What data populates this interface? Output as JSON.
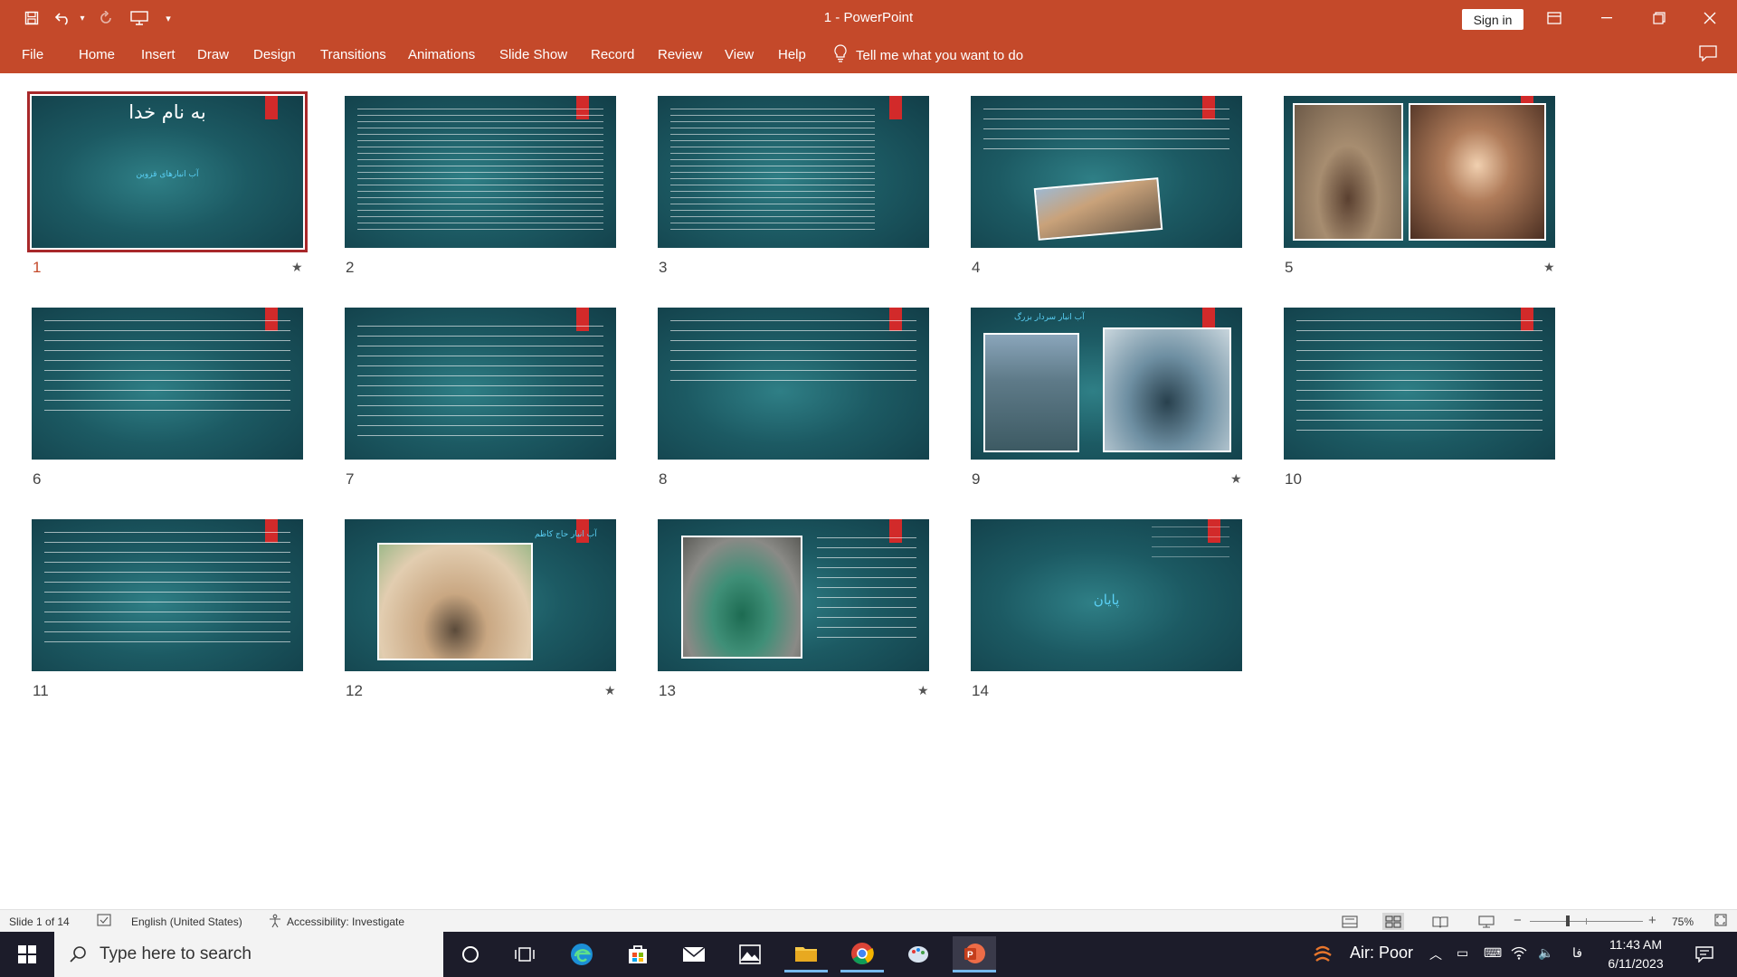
{
  "app": {
    "title": "1  -  PowerPoint",
    "sign_in": "Sign in",
    "colors": {
      "accent": "#c4492a",
      "slide_bg": "#1c5a63",
      "selected_border": "#a8282a",
      "flag": "#d22a2a"
    }
  },
  "quick_access": [
    {
      "name": "save-icon",
      "glyph": "💾"
    },
    {
      "name": "undo-icon",
      "glyph": "↶"
    },
    {
      "name": "redo-icon",
      "glyph": "↻"
    },
    {
      "name": "present-from-beginning-icon",
      "glyph": "▣"
    },
    {
      "name": "customize-qat-icon",
      "glyph": "▾"
    }
  ],
  "window_controls": {
    "ribbon_display": "▭",
    "minimize": "—",
    "restore": "❐",
    "close": "✕"
  },
  "menu_tabs": [
    "File",
    "Home",
    "Insert",
    "Draw",
    "Design",
    "Transitions",
    "Animations",
    "Slide Show",
    "Record",
    "Review",
    "View",
    "Help"
  ],
  "tell_me": {
    "icon": "lightbulb-icon",
    "text": "Tell me what you want to do"
  },
  "slides": [
    {
      "number": "1",
      "selected": true,
      "has_animation": true,
      "title": "به نام خدا",
      "subtitle": "آب انبارهای قزوین"
    },
    {
      "number": "2",
      "selected": false,
      "has_animation": false
    },
    {
      "number": "3",
      "selected": false,
      "has_animation": false
    },
    {
      "number": "4",
      "selected": false,
      "has_animation": false
    },
    {
      "number": "5",
      "selected": false,
      "has_animation": true
    },
    {
      "number": "6",
      "selected": false,
      "has_animation": false
    },
    {
      "number": "7",
      "selected": false,
      "has_animation": false
    },
    {
      "number": "8",
      "selected": false,
      "has_animation": false
    },
    {
      "number": "9",
      "selected": false,
      "has_animation": true,
      "title": "آب انبار سردار بزرگ"
    },
    {
      "number": "10",
      "selected": false,
      "has_animation": false
    },
    {
      "number": "11",
      "selected": false,
      "has_animation": false
    },
    {
      "number": "12",
      "selected": false,
      "has_animation": true,
      "title": "آب انبار حاج کاظم"
    },
    {
      "number": "13",
      "selected": false,
      "has_animation": true
    },
    {
      "number": "14",
      "selected": false,
      "has_animation": false,
      "title": "پایان"
    }
  ],
  "status": {
    "slide_count": "Slide 1 of 14",
    "language": "English (United States)",
    "accessibility": "Accessibility: Investigate",
    "zoom": "75%",
    "zoom_minus": "−",
    "zoom_plus": "+",
    "zoom_level": 0.75
  },
  "taskbar": {
    "search_placeholder": "Type here to search",
    "weather": "Air: Poor",
    "lang_indicator": "فا",
    "time": "11:43 AM",
    "date": "6/11/2023"
  }
}
